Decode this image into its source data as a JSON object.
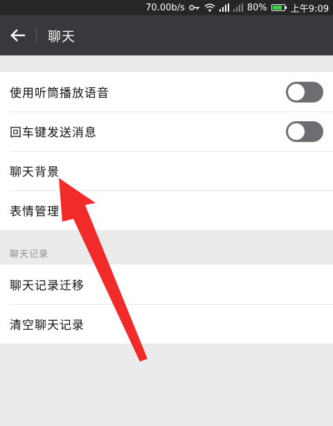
{
  "status_bar": {
    "speed": "70.00b/s",
    "battery_percent": "80%",
    "battery_level": 0.8,
    "time": "上午9:09",
    "icons": [
      "key-icon",
      "wifi-icon",
      "signal-icon",
      "signal-icon-2",
      "battery-icon"
    ]
  },
  "header": {
    "title": "聊天",
    "back_icon": "arrow-left-icon"
  },
  "settings": {
    "group1": [
      {
        "label": "使用听筒播放语音",
        "toggle": false
      },
      {
        "label": "回车键发送消息",
        "toggle": false
      },
      {
        "label": "聊天背景"
      },
      {
        "label": "表情管理"
      }
    ],
    "section_title": "聊天记录",
    "group2": [
      {
        "label": "聊天记录迁移"
      },
      {
        "label": "清空聊天记录"
      }
    ]
  },
  "colors": {
    "status_bar_bg": "#262629",
    "title_bar_bg": "#39393d",
    "page_bg": "#ebebeb",
    "toggle_off": "#6e6e72",
    "annotation_arrow": "#f12a2a",
    "battery_green": "#3cd34a"
  }
}
